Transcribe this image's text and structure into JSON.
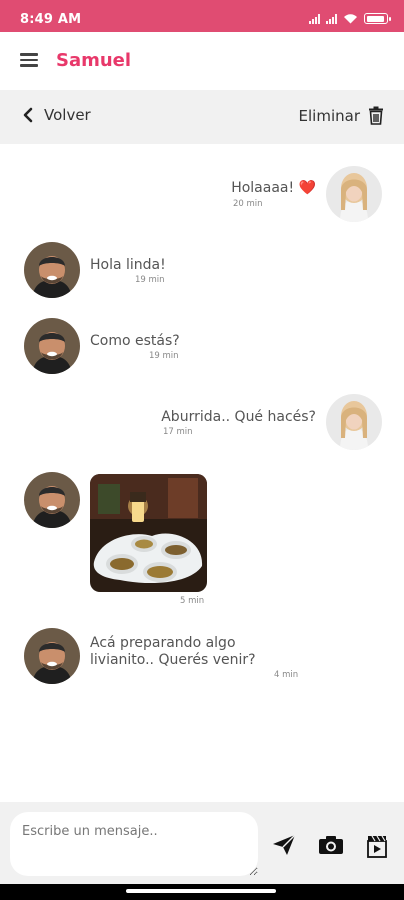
{
  "status_bar": {
    "time": "8:49 AM",
    "battery_level": 0.85
  },
  "header": {
    "title": "Samuel",
    "menu_icon": "menu-icon"
  },
  "subheader": {
    "back_label": "Volver",
    "delete_label": "Eliminar"
  },
  "messages": [
    {
      "side": "right",
      "text": "Holaaaa! ❤️",
      "time": "20 min",
      "avatar": "woman-avatar"
    },
    {
      "side": "left",
      "text": "Hola linda!",
      "time": "19 min",
      "avatar": "samuel-avatar"
    },
    {
      "side": "left",
      "text": "Como estás?",
      "time": "19 min",
      "avatar": "samuel-avatar"
    },
    {
      "side": "right",
      "text": "Aburrida.. Qué hacés?",
      "time": "17 min",
      "avatar": "woman-avatar"
    },
    {
      "side": "left",
      "image": "photo-snacks",
      "time": "5 min",
      "avatar": "samuel-avatar"
    },
    {
      "side": "left",
      "text_lines": [
        "Acá preparando algo",
        "livianito.. Querés venir?"
      ],
      "time": "4 min",
      "avatar": "samuel-avatar"
    }
  ],
  "composer": {
    "placeholder": "Escribe un mensaje..",
    "icons": [
      "send-icon",
      "camera-icon",
      "video-icon"
    ]
  },
  "colors": {
    "accent": "#e04c72",
    "title": "#e8386a",
    "bar_bg": "#f1f1f1"
  }
}
